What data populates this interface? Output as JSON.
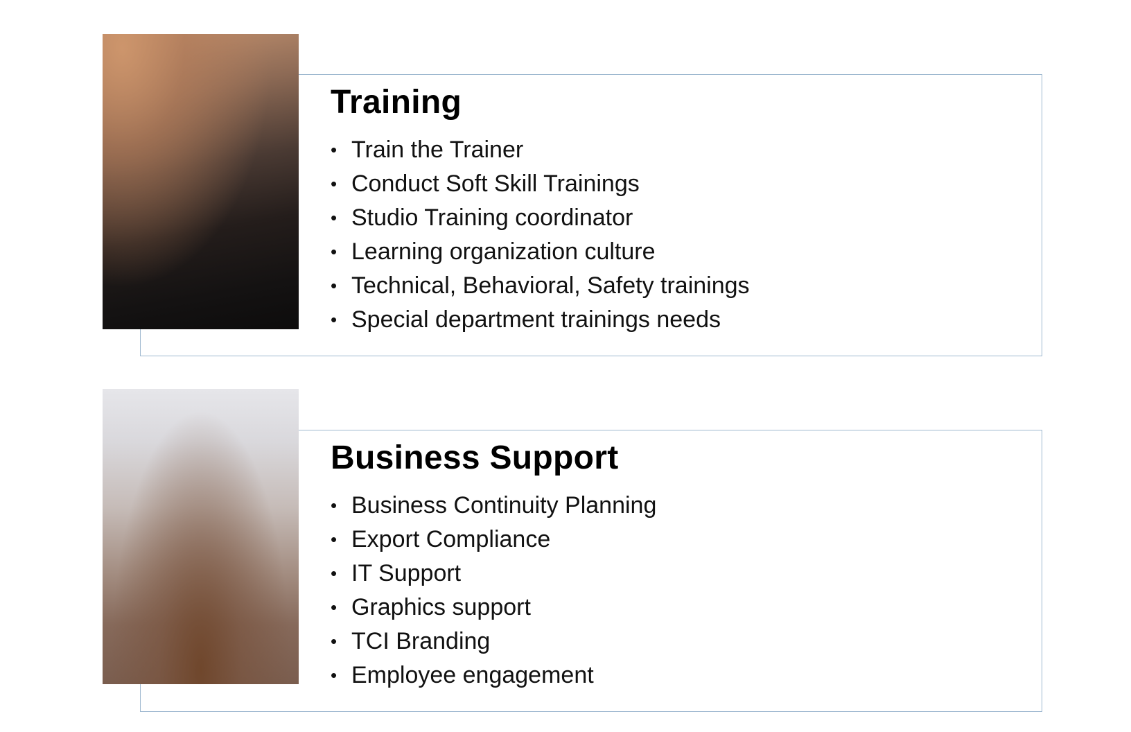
{
  "sections": [
    {
      "title": "Training",
      "items": [
        "Train the Trainer",
        "Conduct Soft Skill Trainings",
        "Studio Training coordinator",
        "Learning organization culture",
        "Technical, Behavioral, Safety trainings",
        "Special department trainings needs"
      ]
    },
    {
      "title": "Business Support",
      "items": [
        "Business Continuity Planning",
        "Export Compliance",
        "IT Support",
        "Graphics support",
        "TCI Branding",
        "Employee engagement"
      ]
    }
  ],
  "bullet_glyph": "•",
  "colors": {
    "card_border": "#9db7cf",
    "text": "#000000"
  }
}
